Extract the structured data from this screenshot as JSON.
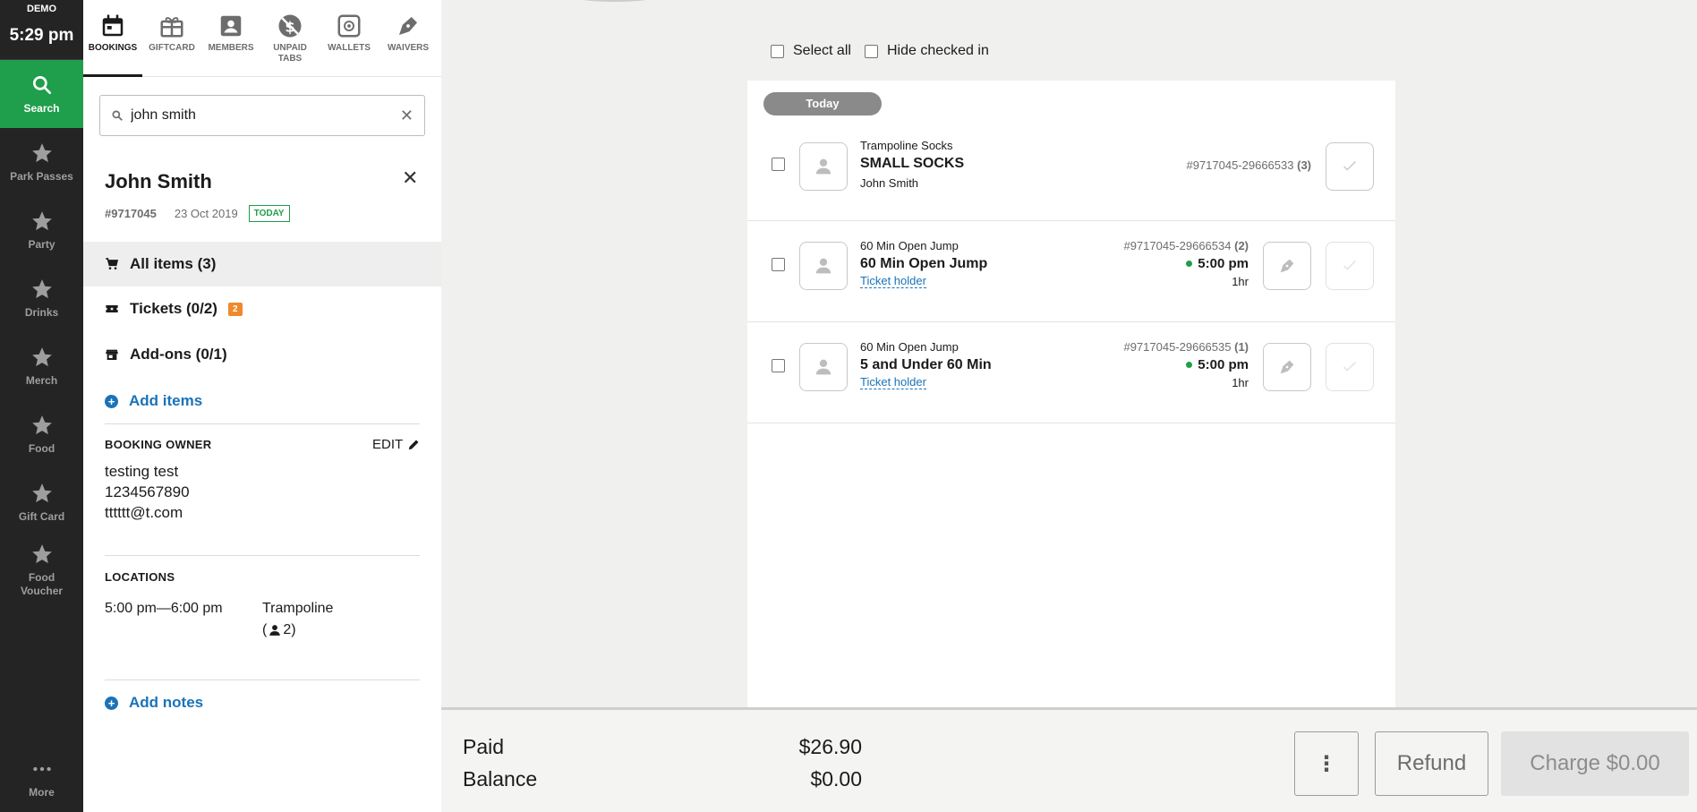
{
  "rail": {
    "demo": "DEMO",
    "time": "5:29 pm",
    "items": [
      {
        "label": "Search"
      },
      {
        "label": "Park Passes"
      },
      {
        "label": "Party"
      },
      {
        "label": "Drinks"
      },
      {
        "label": "Merch"
      },
      {
        "label": "Food"
      },
      {
        "label": "Gift Card"
      },
      {
        "label": "Food Voucher"
      }
    ],
    "more": "More"
  },
  "tabs": [
    {
      "label": "BOOKINGS"
    },
    {
      "label": "GIFTCARD"
    },
    {
      "label": "MEMBERS"
    },
    {
      "label": "UNPAID TABS"
    },
    {
      "label": "WALLETS"
    },
    {
      "label": "WAIVERS"
    }
  ],
  "search": {
    "value": "john smith"
  },
  "customer": {
    "name": "John Smith",
    "id": "#9717045",
    "date": "23 Oct 2019",
    "today_badge": "TODAY"
  },
  "menu": {
    "all_items": "All items (3)",
    "tickets": "Tickets (0/2)",
    "tickets_badge": "2",
    "addons": "Add-ons (0/1)",
    "add_items": "Add items"
  },
  "owner": {
    "title": "BOOKING OWNER",
    "edit": "EDIT",
    "name": "testing test",
    "phone": "1234567890",
    "email": "tttttt@t.com"
  },
  "locations": {
    "title": "LOCATIONS",
    "time": "5:00 pm—6:00 pm",
    "place": "Trampoline",
    "count": "( 2)"
  },
  "add_notes": "Add notes",
  "filters": {
    "select_all": "Select all",
    "hide_checked": "Hide checked in"
  },
  "list": {
    "day": "Today",
    "rows": [
      {
        "category": "Trampoline Socks",
        "title": "SMALL SOCKS",
        "sub": "John Smith",
        "ref": "#9717045-29666533",
        "qty": "(3)"
      },
      {
        "category": "60 Min Open Jump",
        "title": "60 Min Open Jump",
        "link": "Ticket holder",
        "ref": "#9717045-29666534",
        "qty": "(2)",
        "time": "5:00 pm",
        "duration": "1hr"
      },
      {
        "category": "60 Min Open Jump",
        "title": "5 and Under 60 Min",
        "link": "Ticket holder",
        "ref": "#9717045-29666535",
        "qty": "(1)",
        "time": "5:00 pm",
        "duration": "1hr"
      }
    ]
  },
  "footer": {
    "paid_label": "Paid",
    "paid_value": "$26.90",
    "balance_label": "Balance",
    "balance_value": "$0.00",
    "more_btn": "⋮",
    "refund": "Refund",
    "charge": "Charge $0.00"
  },
  "colors": {
    "rail": "#242424",
    "accent_green": "#1f9e4b",
    "link_blue": "#1a73b8",
    "badge_orange": "#f0892c"
  }
}
